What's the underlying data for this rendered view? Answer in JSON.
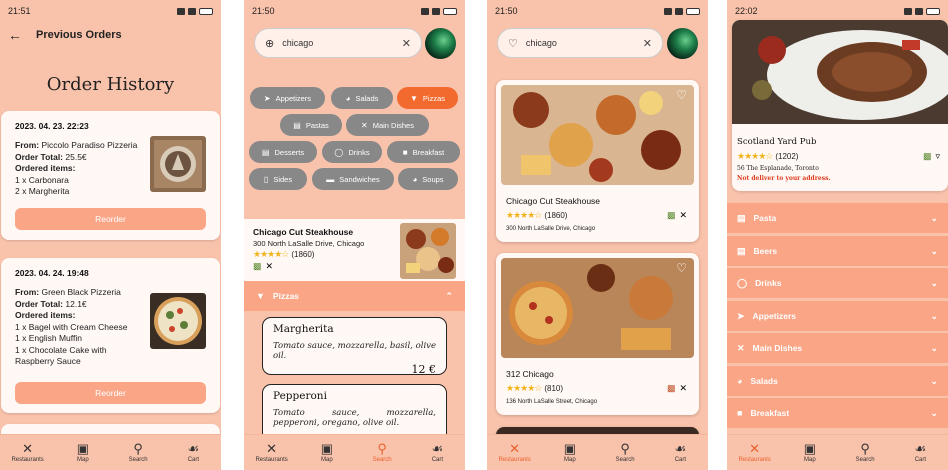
{
  "screens": {
    "orders": {
      "status_time": "21:51",
      "header_title": "Previous Orders",
      "history_title": "Order History",
      "orders": [
        {
          "date": "2023. 04. 23. 22:23",
          "from_label": "From:",
          "from": "Piccolo Paradiso Pizzeria",
          "total_label": "Order Total:",
          "total": "25.5€",
          "items_label": "Ordered items:",
          "items": [
            "1 x Carbonara",
            "2 x Margherita"
          ],
          "reorder": "Reorder"
        },
        {
          "date": "2023. 04. 24. 19:48",
          "from_label": "From:",
          "from": "Green Black Pizzeria",
          "total_label": "Order Total:",
          "total": "12.1€",
          "items_label": "Ordered items:",
          "items": [
            "1 x Bagel with Cream Cheese",
            "1 x English Muffin",
            "1 x Chocolate Cake with Raspberry Sauce"
          ],
          "reorder": "Reorder"
        }
      ]
    },
    "restaurant_detail": {
      "status_time": "21:50",
      "search_value": "chicago",
      "categories": [
        {
          "label": "Appetizers",
          "icon": "appetizer-icon",
          "active": false
        },
        {
          "label": "Salads",
          "icon": "salad-icon",
          "active": false
        },
        {
          "label": "Pizzas",
          "icon": "pizza-icon",
          "active": true
        },
        {
          "label": "Pastas",
          "icon": "pasta-icon",
          "active": false
        },
        {
          "label": "Main Dishes",
          "icon": "main-dish-icon",
          "active": false
        },
        {
          "label": "Desserts",
          "icon": "dessert-icon",
          "active": false
        },
        {
          "label": "Drinks",
          "icon": "drink-icon",
          "active": false
        },
        {
          "label": "Breakfast",
          "icon": "breakfast-icon",
          "active": false
        },
        {
          "label": "Sides",
          "icon": "sides-icon",
          "active": false
        },
        {
          "label": "Sandwiches",
          "icon": "sandwich-icon",
          "active": false
        },
        {
          "label": "Soups",
          "icon": "soup-icon",
          "active": false
        }
      ],
      "restaurant": {
        "name": "Chicago Cut Steakhouse",
        "address": "300 North LaSalle Drive, Chicago",
        "rating_count": "(1860)"
      },
      "section_title": "Pizzas",
      "menu_items": [
        {
          "name": "Margherita",
          "description": "Tomato sauce, mozzarella, basil, olive oil.",
          "price": "12 €"
        },
        {
          "name": "Pepperoni",
          "description": "Tomato sauce, mozzarella, pepperoni, oregano, olive oil.",
          "price": ""
        }
      ]
    },
    "search_results": {
      "status_time": "21:50",
      "search_value": "chicago",
      "results": [
        {
          "name": "Chicago Cut Steakhouse",
          "rating_count": "(1860)",
          "address": "300 North LaSalle Drive, Chicago"
        },
        {
          "name": "312 Chicago",
          "rating_count": "(810)",
          "address": "136 North LaSalle Street, Chicago"
        }
      ]
    },
    "restaurant_menu": {
      "status_time": "22:02",
      "name": "Scotland Yard Pub",
      "rating_count": "(1202)",
      "address": "56 The Esplanade, Toronto",
      "warning": "Not deliver to your address.",
      "categories": [
        "Pasta",
        "Beers",
        "Drinks",
        "Appetizers",
        "Main Dishes",
        "Salads",
        "Breakfast"
      ]
    }
  },
  "nav": {
    "restaurants": "Restaurants",
    "map": "Map",
    "search": "Search",
    "cart": "Cart"
  },
  "colors": {
    "background": "#f9c2ab",
    "accent": "#f26a2e",
    "category_bar": "#f9a586",
    "star": "#f2b41d",
    "warning": "#e03b1d"
  }
}
